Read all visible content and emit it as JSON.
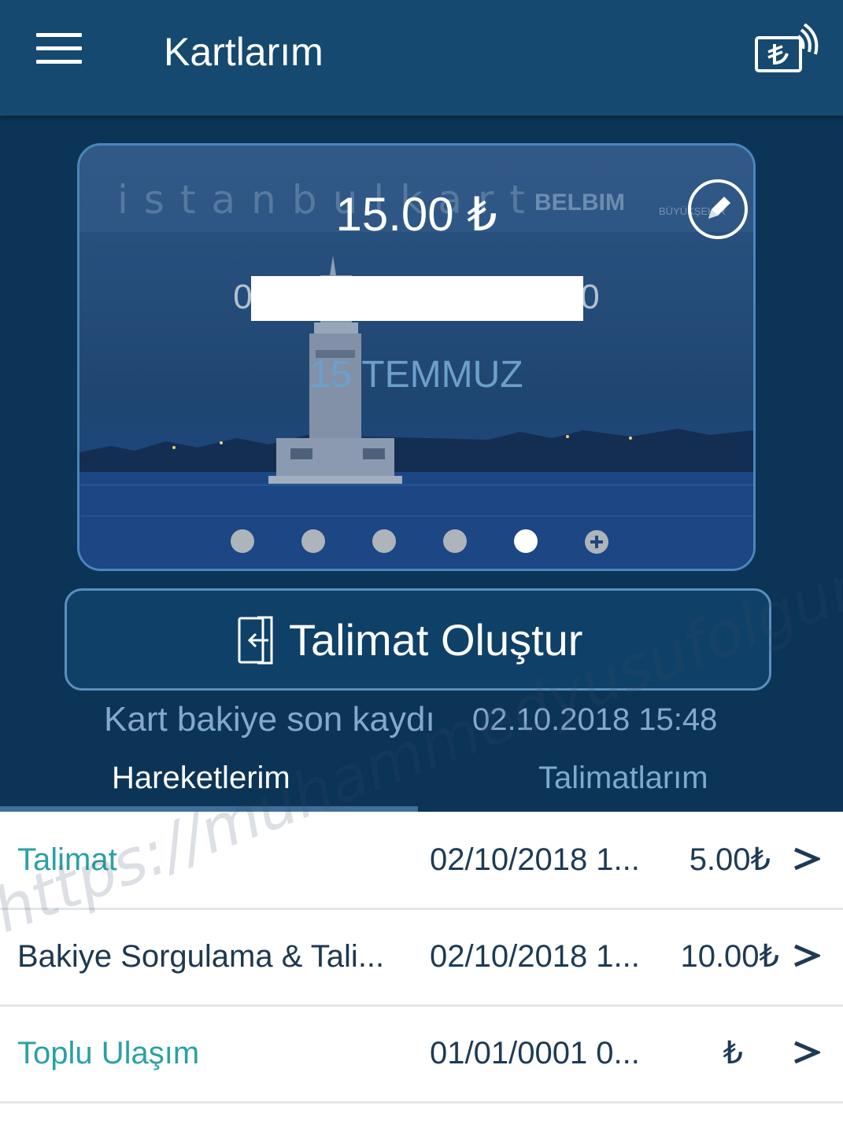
{
  "header": {
    "title": "Kartlarım",
    "menu_icon": "hamburger-menu-icon",
    "nfc_icon": "lira-nfc-icon"
  },
  "card": {
    "brand": "istanbulkart",
    "brand_partner": "BELBIM",
    "brand_municipality": "BÜYÜKŞEHİR",
    "balance": "15.00 ₺",
    "number_prefix": "04",
    "number_suffix": "0",
    "name": "15 TEMMUZ",
    "edit_icon": "pencil-icon",
    "pager": {
      "count": 5,
      "active_index": 4,
      "add_icon": "plus-circle-icon"
    }
  },
  "actions": {
    "create_instruction": "Talimat Oluştur",
    "create_instruction_icon": "card-insert-icon"
  },
  "status": {
    "last_record_label": "Kart bakiye son kaydı",
    "last_record_value": "02.10.2018 15:48"
  },
  "tabs": [
    {
      "label": "Hareketlerim",
      "active": true
    },
    {
      "label": "Talimatlarım",
      "active": false
    }
  ],
  "transactions": [
    {
      "type": "Talimat",
      "date": "02/10/2018 1...",
      "amount": "5.00₺"
    },
    {
      "type": "Bakiye Sorgulama & Tali...",
      "date": "02/10/2018 1...",
      "amount": "10.00₺"
    },
    {
      "type": "Toplu Ulaşım",
      "date": "01/01/0001 0...",
      "amount": "₺"
    }
  ],
  "watermark": "https://muhammedyusufolgun.blogspot.com",
  "colors": {
    "header": "#16496f",
    "background": "#0b3457",
    "accent_teal": "#2ba1a3",
    "text_dark": "#1e3a55"
  }
}
